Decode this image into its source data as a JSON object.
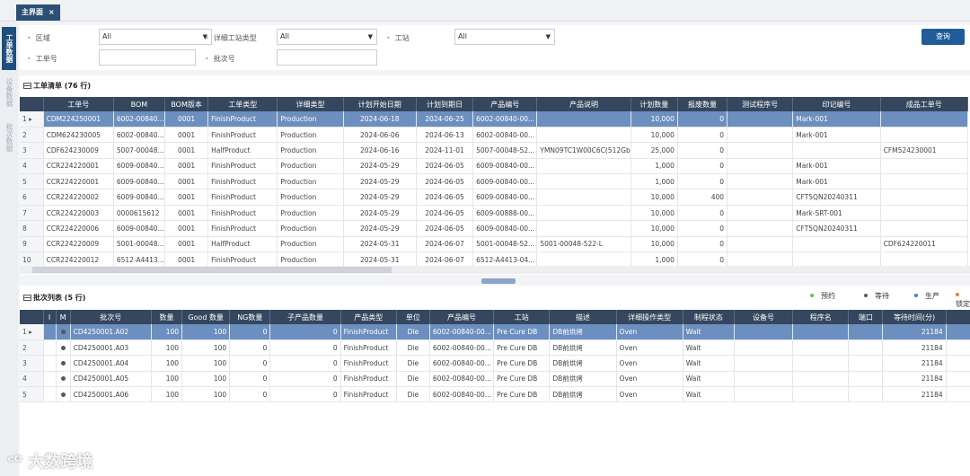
{
  "tab": {
    "label": "主界面",
    "close": "×"
  },
  "side_tabs": [
    "工单数据",
    "设备数据",
    "批次数据"
  ],
  "filters": {
    "area_label": "区域",
    "area_value": "All",
    "station_type_label": "详细工站类型",
    "station_type_value": "All",
    "station_label": "工站",
    "station_value": "All",
    "order_label": "工单号",
    "order_value": "",
    "lot_label": "批次号",
    "lot_value": "",
    "query_button": "查询"
  },
  "orders": {
    "title": "工单清单 (76 行)",
    "columns": [
      "",
      "工单号",
      "BOM",
      "BOM版本",
      "工单类型",
      "详细类型",
      "计划开始日期",
      "计划到期日",
      "产品编号",
      "产品说明",
      "计划数量",
      "报废数量",
      "测试程序号",
      "印记编号",
      "成品工单号"
    ],
    "rows": [
      [
        "1",
        "CDM224250001",
        "6002-00840...",
        "0001",
        "FinishProduct",
        "Production",
        "2024-06-18",
        "2024-06-25",
        "6002-00840-00...",
        "",
        "10,000",
        "0",
        "",
        "Mark-001",
        ""
      ],
      [
        "2",
        "CDM624230005",
        "6002-00840...",
        "0001",
        "FinishProduct",
        "Production",
        "2024-06-06",
        "2024-06-13",
        "6002-00840-00...",
        "",
        "10,000",
        "0",
        "",
        "Mark-001",
        ""
      ],
      [
        "3",
        "CDF624230009",
        "5007-00048...",
        "0001",
        "HalfProduct",
        "Production",
        "2024-06-16",
        "2024-11-01",
        "5007-00048-52...",
        "YMN09TC1W00C6C(512Gb...",
        "25,000",
        "0",
        "",
        "",
        "CFM524230001"
      ],
      [
        "4",
        "CCR224220001",
        "6009-00840...",
        "0001",
        "FinishProduct",
        "Production",
        "2024-05-29",
        "2024-06-05",
        "6009-00840-00...",
        "",
        "1,000",
        "0",
        "",
        "Mark-001",
        ""
      ],
      [
        "5",
        "CCR224220001",
        "6009-00840...",
        "0001",
        "FinishProduct",
        "Production",
        "2024-05-29",
        "2024-06-05",
        "6009-00840-00...",
        "",
        "1,000",
        "0",
        "",
        "Mark-001",
        ""
      ],
      [
        "6",
        "CCR224220002",
        "6009-00840...",
        "0001",
        "FinishProduct",
        "Production",
        "2024-05-29",
        "2024-06-05",
        "6009-00840-00...",
        "",
        "10,000",
        "400",
        "",
        "CFT5QN20240311",
        ""
      ],
      [
        "7",
        "CCR224220003",
        "0000615612",
        "0001",
        "FinishProduct",
        "Production",
        "2024-05-29",
        "2024-06-05",
        "6009-00888-00...",
        "",
        "10,000",
        "0",
        "",
        "Mark-SRT-001",
        ""
      ],
      [
        "8",
        "CCR224220006",
        "6009-00840...",
        "0001",
        "FinishProduct",
        "Production",
        "2024-05-29",
        "2024-06-05",
        "6009-00840-00...",
        "",
        "10,000",
        "0",
        "",
        "CFT5QN20240311",
        ""
      ],
      [
        "9",
        "CCR224220009",
        "5001-00048...",
        "0001",
        "HalfProduct",
        "Production",
        "2024-05-31",
        "2024-06-07",
        "5001-00048-52...",
        "5001-00048-522-L",
        "10,000",
        "0",
        "",
        "",
        "CDF624220011"
      ],
      [
        "10",
        "CCR224220012",
        "6512-A4413...",
        "0001",
        "FinishProduct",
        "Production",
        "2024-05-31",
        "2024-06-07",
        "6512-A4413-04...",
        "",
        "1,000",
        "0",
        "",
        "",
        ""
      ]
    ]
  },
  "lots": {
    "title": "批次列表 (5 行)",
    "legend": [
      {
        "label": "预约",
        "color": "#6cc04a"
      },
      {
        "label": "等待",
        "color": "#555b66"
      },
      {
        "label": "生产",
        "color": "#2a8ad4"
      },
      {
        "label": "锁定",
        "color": "#f07a2a"
      }
    ],
    "columns": [
      "",
      "I",
      "M",
      "批次号",
      "数量",
      "Good 数量",
      "NG数量",
      "子产品数量",
      "产品类型",
      "单位",
      "产品编号",
      "工站",
      "描述",
      "详细操作类型",
      "制程状态",
      "设备号",
      "程序名",
      "端口",
      "等待时间(分)",
      ""
    ],
    "rows": [
      [
        "1",
        "",
        "",
        "CD4250001.A02",
        "100",
        "100",
        "0",
        "0",
        "FinishProduct",
        "Die",
        "6002-00840-00...",
        "Pre Cure DB",
        "DB前烘烤",
        "Oven",
        "Wait",
        "",
        "",
        "",
        "21184",
        ""
      ],
      [
        "2",
        "",
        "",
        "CD4250001.A03",
        "100",
        "100",
        "0",
        "0",
        "FinishProduct",
        "Die",
        "6002-00840-00...",
        "Pre Cure DB",
        "DB前烘烤",
        "Oven",
        "Wait",
        "",
        "",
        "",
        "21184",
        ""
      ],
      [
        "3",
        "",
        "",
        "CD4250001.A04",
        "100",
        "100",
        "0",
        "0",
        "FinishProduct",
        "Die",
        "6002-00840-00...",
        "Pre Cure DB",
        "DB前烘烤",
        "Oven",
        "Wait",
        "",
        "",
        "",
        "21184",
        ""
      ],
      [
        "4",
        "",
        "",
        "CD4250001.A05",
        "100",
        "100",
        "0",
        "0",
        "FinishProduct",
        "Die",
        "6002-00840-00...",
        "Pre Cure DB",
        "DB前烘烤",
        "Oven",
        "Wait",
        "",
        "",
        "",
        "21184",
        ""
      ],
      [
        "5",
        "",
        "",
        "CD4250001.A06",
        "100",
        "100",
        "0",
        "0",
        "FinishProduct",
        "Die",
        "6002-00840-00...",
        "Pre Cure DB",
        "DB前烘烤",
        "Oven",
        "Wait",
        "",
        "",
        "",
        "21184",
        ""
      ]
    ]
  },
  "watermark": "大数跨境"
}
